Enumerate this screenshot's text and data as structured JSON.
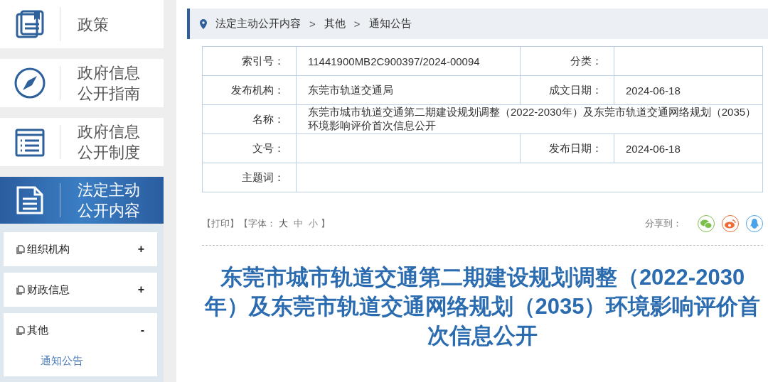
{
  "sidebar": {
    "nav_items": [
      {
        "label": "政策",
        "kind": "book",
        "selected": false
      },
      {
        "label": "政府信息公开指南",
        "kind": "compass",
        "selected": false
      },
      {
        "label": "政府信息公开制度",
        "kind": "list",
        "selected": false
      },
      {
        "label": "法定主动公开内容",
        "kind": "document",
        "selected": true
      }
    ],
    "sub_items": [
      {
        "label": "组织机构",
        "toggle": "+"
      },
      {
        "label": "财政信息",
        "toggle": "+"
      },
      {
        "label": "其他",
        "toggle": "-",
        "children": [
          {
            "label": "通知公告",
            "selected": true
          }
        ]
      }
    ]
  },
  "breadcrumb": [
    "法定主动公开内容",
    "其他",
    "通知公告"
  ],
  "breadcrumb_separator": ">",
  "info_table": {
    "rows": [
      {
        "cells": [
          {
            "label": "索引号：",
            "value": "11441900MB2C900397/2024-00094"
          },
          {
            "label": "分类："
          }
        ]
      },
      {
        "cells": [
          {
            "label": "发布机构：",
            "value": "东莞市轨道交通局"
          },
          {
            "label": "成文日期：",
            "value": "2024-06-18"
          }
        ]
      },
      {
        "cells": [
          {
            "label": "名称：",
            "value": "东莞市城市轨道交通第二期建设规划调整（2022-2030年）及东莞市轨道交通网络规划（2035）环境影响评价首次信息公开"
          }
        ]
      },
      {
        "cells": [
          {
            "label": "文号："
          },
          {
            "label": "发布日期：",
            "value": "2024-06-18"
          }
        ]
      },
      {
        "cells": [
          {
            "label": "主题词："
          }
        ]
      }
    ]
  },
  "toolbar": {
    "print": "【打印】",
    "font_label": "【字体：",
    "font_sizes": [
      {
        "label": "大",
        "selected": true
      },
      {
        "label": "中",
        "selected": false
      },
      {
        "label": "小",
        "selected": false
      }
    ],
    "font_close": "】",
    "share_label": "分享到：",
    "share": [
      {
        "kind": "wechat"
      },
      {
        "kind": "weibo"
      },
      {
        "kind": "qq"
      }
    ]
  },
  "article": {
    "title": "东莞市城市轨道交通第二期建设规划调整（2022-2030年）及东莞市轨道交通网络规划（2035）环境影响评价首次信息公开"
  }
}
